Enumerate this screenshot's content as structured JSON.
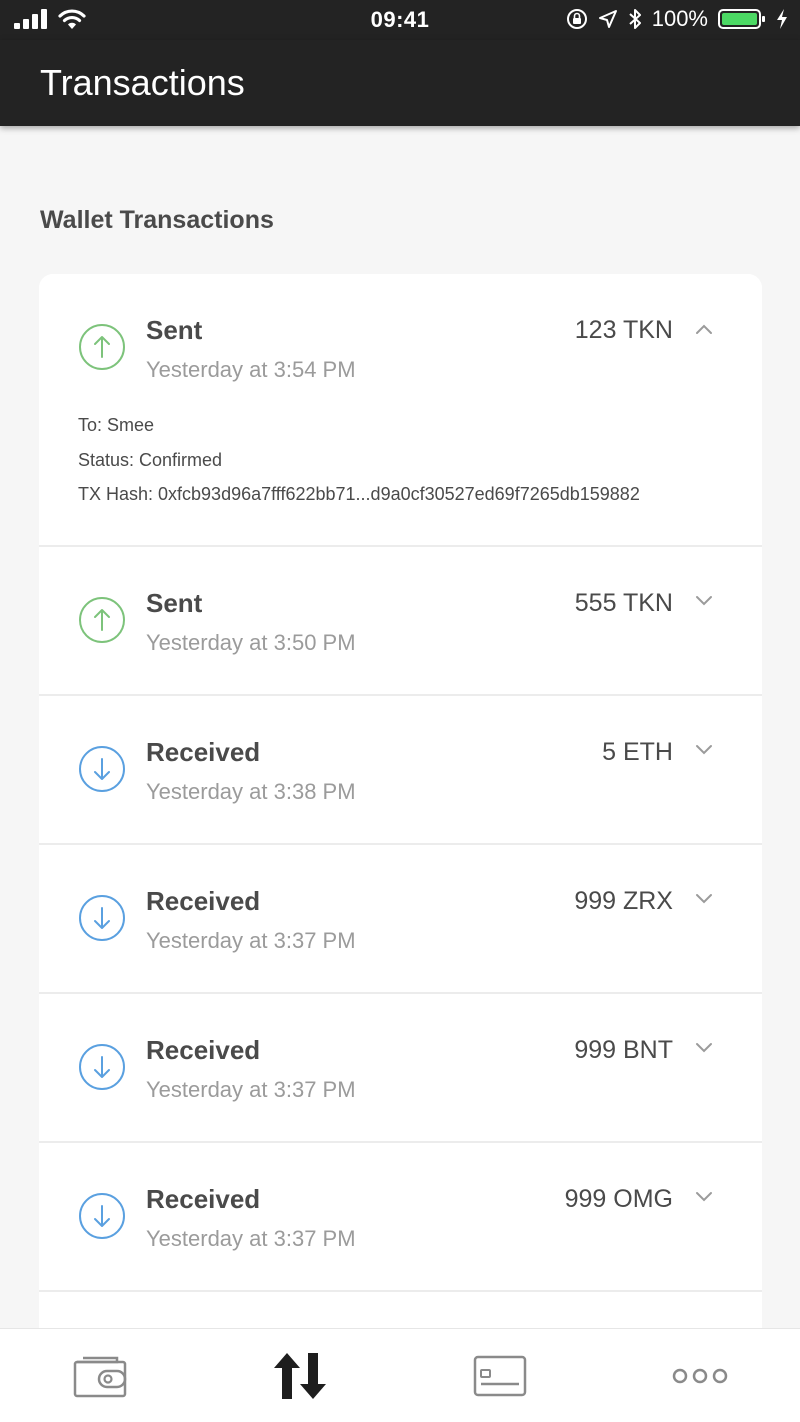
{
  "status_bar": {
    "time": "09:41",
    "battery": "100%"
  },
  "header": {
    "title": "Transactions"
  },
  "section": {
    "title": "Wallet Transactions"
  },
  "transactions": [
    {
      "type": "Sent",
      "time": "Yesterday at 3:54 PM",
      "amount": "123 TKN",
      "direction": "sent",
      "expanded": true,
      "details": {
        "to": "To: Smee",
        "status": "Status: Confirmed",
        "hash": "TX Hash: 0xfcb93d96a7fff622bb71...d9a0cf30527ed69f7265db159882"
      }
    },
    {
      "type": "Sent",
      "time": "Yesterday at 3:50 PM",
      "amount": "555 TKN",
      "direction": "sent",
      "expanded": false
    },
    {
      "type": "Received",
      "time": "Yesterday at 3:38 PM",
      "amount": "5 ETH",
      "direction": "received",
      "expanded": false
    },
    {
      "type": "Received",
      "time": "Yesterday at 3:37 PM",
      "amount": "999 ZRX",
      "direction": "received",
      "expanded": false
    },
    {
      "type": "Received",
      "time": "Yesterday at 3:37 PM",
      "amount": "999 BNT",
      "direction": "received",
      "expanded": false
    },
    {
      "type": "Received",
      "time": "Yesterday at 3:37 PM",
      "amount": "999 OMG",
      "direction": "received",
      "expanded": false
    }
  ],
  "tab_bar": {
    "tabs": [
      {
        "icon": "wallet-icon",
        "active": false
      },
      {
        "icon": "transfer-arrows-icon",
        "active": true
      },
      {
        "icon": "card-icon",
        "active": false
      },
      {
        "icon": "more-dots-icon",
        "active": false
      }
    ]
  },
  "colors": {
    "header_bg": "#232323",
    "sent": "#7dc37b",
    "received": "#5aa0e0",
    "battery": "#4cd964"
  }
}
